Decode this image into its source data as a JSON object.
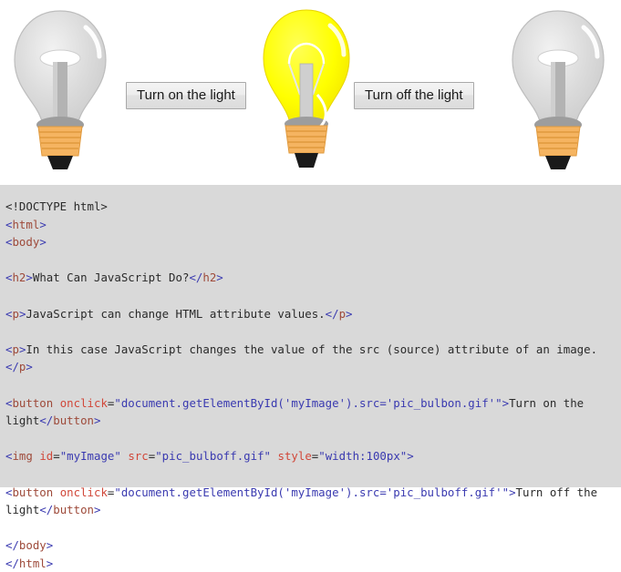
{
  "demo": {
    "bulbs": [
      {
        "name": "bulb-off-left",
        "state": "off",
        "alt": "light bulb off"
      },
      {
        "name": "bulb-on-center",
        "state": "on",
        "alt": "light bulb on"
      },
      {
        "name": "bulb-off-right",
        "state": "off",
        "alt": "light bulb off"
      }
    ],
    "turn_on_label": "Turn on the light",
    "turn_off_label": "Turn off the light",
    "colors": {
      "bulb_on_glass": "#ffff00",
      "bulb_off_glass": "#d9d9d9",
      "bulb_base": "#f5b461",
      "bulb_tip": "#111111",
      "button_face": "#ededed",
      "button_border": "#a9a9a9",
      "code_background": "#d9d9d9"
    }
  },
  "code": {
    "lines": [
      {
        "id": "doctype",
        "tokens": [
          {
            "c": "txt",
            "t": "<!DOCTYPE html>"
          }
        ]
      },
      {
        "id": "html-open",
        "tokens": [
          {
            "c": "pun",
            "t": "<"
          },
          {
            "c": "tag",
            "t": "html"
          },
          {
            "c": "pun",
            "t": ">"
          }
        ]
      },
      {
        "id": "body-open",
        "tokens": [
          {
            "c": "pun",
            "t": "<"
          },
          {
            "c": "tag",
            "t": "body"
          },
          {
            "c": "pun",
            "t": ">"
          }
        ]
      },
      {
        "id": "blank-1",
        "tokens": []
      },
      {
        "id": "h2",
        "tokens": [
          {
            "c": "pun",
            "t": "<"
          },
          {
            "c": "tag",
            "t": "h2"
          },
          {
            "c": "pun",
            "t": ">"
          },
          {
            "c": "txt",
            "t": "What Can JavaScript Do?"
          },
          {
            "c": "pun",
            "t": "</"
          },
          {
            "c": "tag",
            "t": "h2"
          },
          {
            "c": "pun",
            "t": ">"
          }
        ]
      },
      {
        "id": "blank-2",
        "tokens": []
      },
      {
        "id": "p-1",
        "tokens": [
          {
            "c": "pun",
            "t": "<"
          },
          {
            "c": "tag",
            "t": "p"
          },
          {
            "c": "pun",
            "t": ">"
          },
          {
            "c": "txt",
            "t": "JavaScript can change HTML attribute values."
          },
          {
            "c": "pun",
            "t": "</"
          },
          {
            "c": "tag",
            "t": "p"
          },
          {
            "c": "pun",
            "t": ">"
          }
        ]
      },
      {
        "id": "blank-3",
        "tokens": []
      },
      {
        "id": "p-2",
        "tokens": [
          {
            "c": "pun",
            "t": "<"
          },
          {
            "c": "tag",
            "t": "p"
          },
          {
            "c": "pun",
            "t": ">"
          },
          {
            "c": "txt",
            "t": "In this case JavaScript changes the value of the src (source) attribute of an image."
          },
          {
            "c": "pun",
            "t": "</"
          },
          {
            "c": "tag",
            "t": "p"
          },
          {
            "c": "pun",
            "t": ">"
          }
        ]
      },
      {
        "id": "blank-4",
        "tokens": []
      },
      {
        "id": "button-on",
        "tokens": [
          {
            "c": "pun",
            "t": "<"
          },
          {
            "c": "tag",
            "t": "button"
          },
          {
            "c": "txt",
            "t": " "
          },
          {
            "c": "attr",
            "t": "onclick"
          },
          {
            "c": "eq",
            "t": "="
          },
          {
            "c": "val",
            "t": "\"document.getElementById('myImage').src='pic_bulbon.gif'\""
          },
          {
            "c": "pun",
            "t": ">"
          },
          {
            "c": "txt",
            "t": "Turn on the light"
          },
          {
            "c": "pun",
            "t": "</"
          },
          {
            "c": "tag",
            "t": "button"
          },
          {
            "c": "pun",
            "t": ">"
          }
        ]
      },
      {
        "id": "blank-5",
        "tokens": []
      },
      {
        "id": "img",
        "tokens": [
          {
            "c": "pun",
            "t": "<"
          },
          {
            "c": "tag",
            "t": "img"
          },
          {
            "c": "txt",
            "t": " "
          },
          {
            "c": "attr",
            "t": "id"
          },
          {
            "c": "eq",
            "t": "="
          },
          {
            "c": "val",
            "t": "\"myImage\""
          },
          {
            "c": "txt",
            "t": " "
          },
          {
            "c": "attr",
            "t": "src"
          },
          {
            "c": "eq",
            "t": "="
          },
          {
            "c": "val",
            "t": "\"pic_bulboff.gif\""
          },
          {
            "c": "txt",
            "t": " "
          },
          {
            "c": "attr",
            "t": "style"
          },
          {
            "c": "eq",
            "t": "="
          },
          {
            "c": "val",
            "t": "\"width:100px\""
          },
          {
            "c": "pun",
            "t": ">"
          }
        ]
      },
      {
        "id": "blank-6",
        "tokens": []
      },
      {
        "id": "button-off",
        "tokens": [
          {
            "c": "pun",
            "t": "<"
          },
          {
            "c": "tag",
            "t": "button"
          },
          {
            "c": "txt",
            "t": " "
          },
          {
            "c": "attr",
            "t": "onclick"
          },
          {
            "c": "eq",
            "t": "="
          },
          {
            "c": "val",
            "t": "\"document.getElementById('myImage').src='pic_bulboff.gif'\""
          },
          {
            "c": "pun",
            "t": ">"
          },
          {
            "c": "txt",
            "t": "Turn off the light"
          },
          {
            "c": "pun",
            "t": "</"
          },
          {
            "c": "tag",
            "t": "button"
          },
          {
            "c": "pun",
            "t": ">"
          }
        ]
      },
      {
        "id": "blank-7",
        "tokens": []
      },
      {
        "id": "body-close",
        "tokens": [
          {
            "c": "pun",
            "t": "</"
          },
          {
            "c": "tag",
            "t": "body"
          },
          {
            "c": "pun",
            "t": ">"
          }
        ]
      },
      {
        "id": "html-close",
        "tokens": [
          {
            "c": "pun",
            "t": "</"
          },
          {
            "c": "tag",
            "t": "html"
          },
          {
            "c": "pun",
            "t": ">"
          }
        ]
      }
    ]
  }
}
